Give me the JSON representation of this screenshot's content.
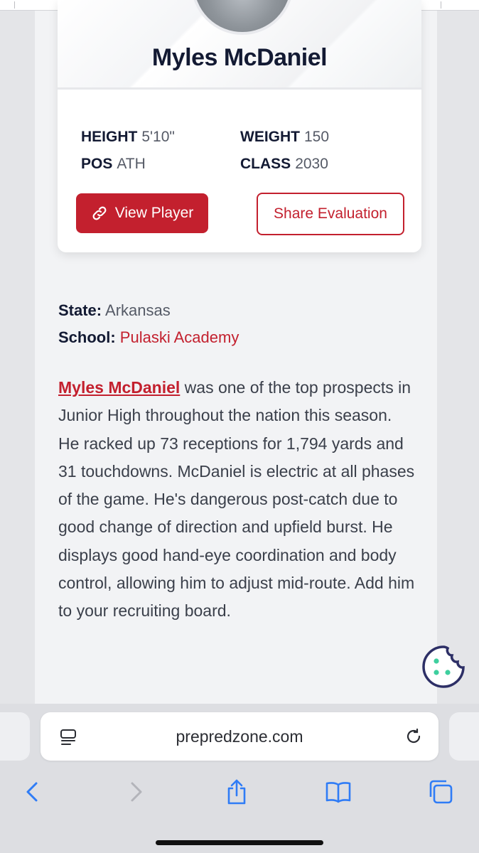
{
  "player": {
    "name": "Myles McDaniel",
    "stats": {
      "height_label": "HEIGHT",
      "height_value": "5'10\"",
      "weight_label": "WEIGHT",
      "weight_value": "150",
      "pos_label": "POS",
      "pos_value": "ATH",
      "class_label": "CLASS",
      "class_value": "2030"
    },
    "view_button": "View Player",
    "share_button": "Share Evaluation"
  },
  "info": {
    "state_label": "State:",
    "state_value": "Arkansas",
    "school_label": "School:",
    "school_value": "Pulaski Academy"
  },
  "article": {
    "link_text": "Myles McDaniel",
    "body": " was one of the top prospects in Junior High throughout the nation this season. He racked up 73 receptions for 1,794 yards and 31 touchdowns. McDaniel is electric at all phases of the game. He's dangerous post-catch due to good change of direction and upfield burst. He displays good hand-eye coordination and body control, allowing him to adjust mid-route. Add him to your recruiting board."
  },
  "browser": {
    "url": "prepredzone.com",
    "icons": [
      "reader-icon",
      "reload-icon",
      "back-icon",
      "forward-icon",
      "share-icon",
      "bookmarks-icon",
      "tabs-icon"
    ]
  },
  "colors": {
    "accent": "#c3202e",
    "heading": "#131a33",
    "cookie": "#2d2f66",
    "cookie_dots": "#3ecf9e"
  }
}
